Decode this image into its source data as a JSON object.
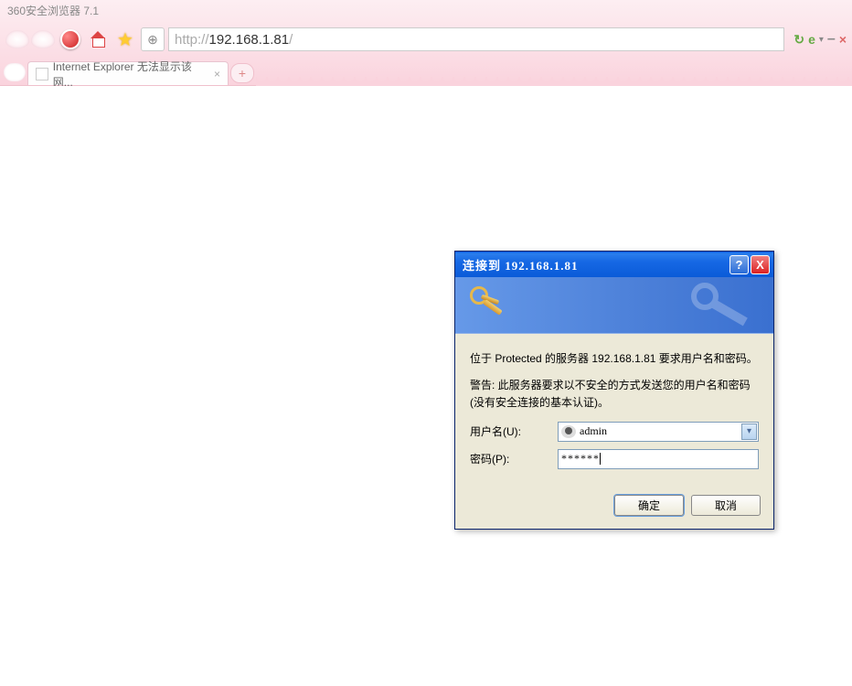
{
  "browser": {
    "title": "360安全浏览器 7.1",
    "url_protocol": "http://",
    "url_host": "192.168.1.81",
    "url_path": "/",
    "tab_title": "Internet Explorer 无法显示该网..."
  },
  "dialog": {
    "title": "连接到 192.168.1.81",
    "message1": "位于 Protected 的服务器 192.168.1.81 要求用户名和密码。",
    "message2": "警告: 此服务器要求以不安全的方式发送您的用户名和密码(没有安全连接的基本认证)。",
    "username_label": "用户名(U):",
    "password_label": "密码(P):",
    "username_value": "admin",
    "password_value": "******",
    "ok_label": "确定",
    "cancel_label": "取消"
  }
}
